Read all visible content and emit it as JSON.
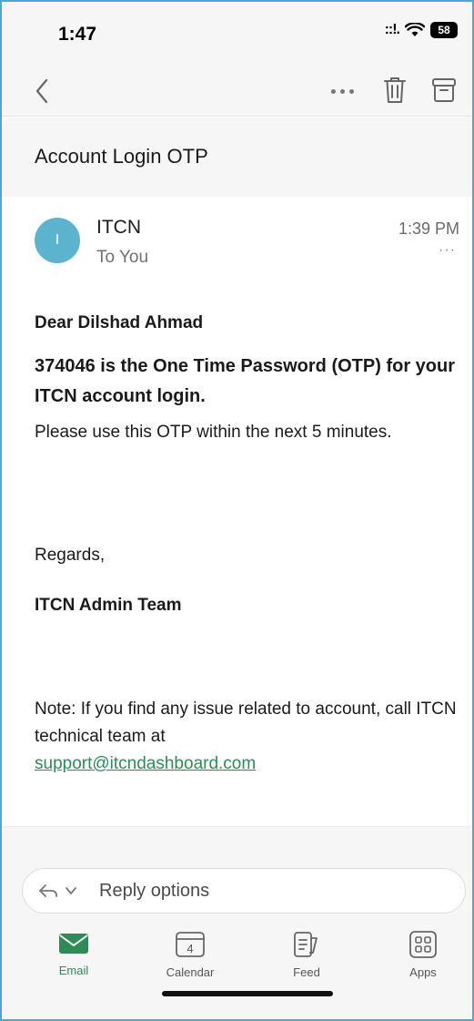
{
  "status_bar": {
    "time": "1:47",
    "battery": "58"
  },
  "email": {
    "subject": "Account Login OTP",
    "sender_initial": "I",
    "sender_name": "ITCN",
    "recipient": "To You",
    "time": "1:39 PM",
    "more": "···",
    "greeting": "Dear Dilshad Ahmad",
    "otp_line": "374046 is the One Time Password (OTP) for your ITCN account login.",
    "instruction": "Please use this OTP within the next 5 minutes.",
    "regards": "Regards,",
    "team": "ITCN Admin Team",
    "note": "Note: If you find any issue related to account, call ITCN technical team at",
    "support_email": "support@itcndashboard.com"
  },
  "reply": {
    "label": "Reply options"
  },
  "tabs": [
    {
      "label": "Email",
      "icon": "envelope-icon",
      "active": true
    },
    {
      "label": "Calendar",
      "icon": "calendar-icon",
      "day": "4"
    },
    {
      "label": "Feed",
      "icon": "feed-icon"
    },
    {
      "label": "Apps",
      "icon": "apps-grid-icon"
    }
  ],
  "colors": {
    "accent": "#2e8b57",
    "avatar": "#5cb3ce",
    "frame": "#49a9cf"
  }
}
